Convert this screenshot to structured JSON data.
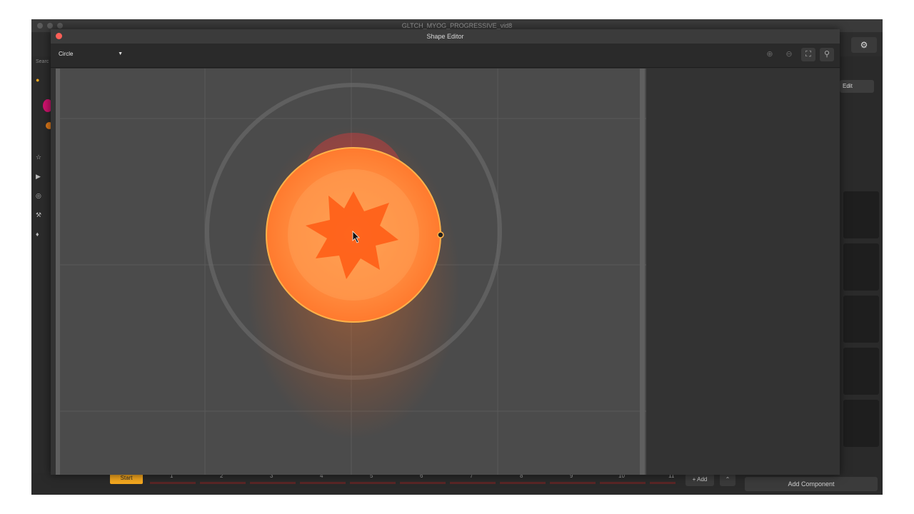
{
  "app": {
    "window_title": "GLTCH_MYOG_PROGRESSIVE_vid8",
    "left_panel_search": "Searc",
    "settings_icon": "gear-icon",
    "edit_label": "Edit"
  },
  "shape_editor": {
    "title": "Shape Editor",
    "shape_type": "Circle",
    "toolbar_icons": [
      "zoom-in-icon",
      "zoom-out-icon",
      "fit-frame-icon",
      "search-icon"
    ]
  },
  "timeline": {
    "start_label": "Start",
    "ticks": [
      "1",
      "2",
      "3",
      "4",
      "5",
      "6",
      "7",
      "8",
      "9",
      "10",
      "11"
    ],
    "add_label": "+ Add",
    "collapse_icon": "chevron-up-icon"
  },
  "components": {
    "add_component_label": "Add Component"
  },
  "colors": {
    "shape_fill": "#ff8a3d",
    "shape_stroke": "#ffb24a",
    "start_button": "#f5a81f",
    "close_button": "#fd5f57"
  }
}
